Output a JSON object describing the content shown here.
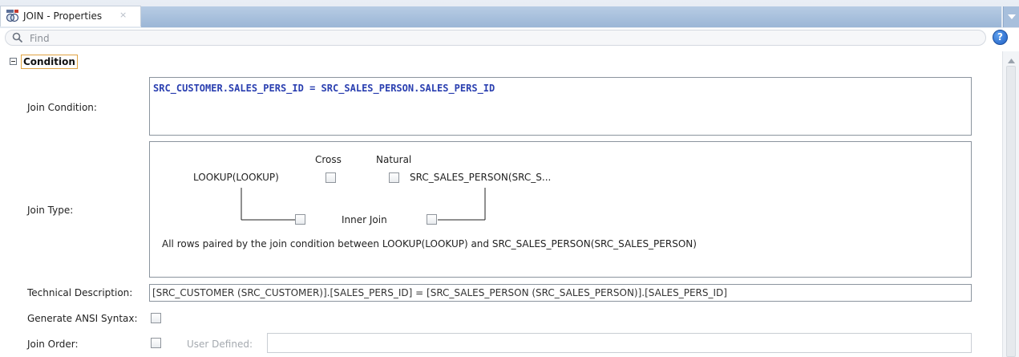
{
  "tab": {
    "title": "JOIN - Properties",
    "close_glyph": "×",
    "icon": "join-properties-icon"
  },
  "find": {
    "placeholder": "Find",
    "value": "",
    "help_glyph": "?"
  },
  "section": {
    "title": "Condition",
    "expanded": true
  },
  "labels": {
    "join_condition": "Join Condition:",
    "join_type": "Join Type:",
    "technical_description": "Technical Description:",
    "generate_ansi": "Generate ANSI Syntax:",
    "join_order": "Join Order:",
    "user_defined": "User Defined:"
  },
  "join_condition": {
    "expression": "SRC_CUSTOMER.SALES_PERS_ID = SRC_SALES_PERSON.SALES_PERS_ID"
  },
  "join_type": {
    "cross_label": "Cross",
    "natural_label": "Natural",
    "left_source": "LOOKUP(LOOKUP)",
    "right_source": "SRC_SALES_PERSON(SRC_S...",
    "inner_join_label": "Inner Join",
    "description": "All rows paired by the join condition between LOOKUP(LOOKUP) and SRC_SALES_PERSON(SRC_SALES_PERSON)",
    "cross_checked": false,
    "natural_checked": false,
    "left_outer_checked": false,
    "right_outer_checked": false
  },
  "technical_description": {
    "value": "[SRC_CUSTOMER (SRC_CUSTOMER)].[SALES_PERS_ID] = [SRC_SALES_PERSON (SRC_SALES_PERSON)].[SALES_PERS_ID]"
  },
  "generate_ansi_checked": false,
  "join_order_checked": false,
  "user_defined": {
    "value": ""
  },
  "colors": {
    "condition_text": "#2a3fb0",
    "tab_strip": "#9bb6d6",
    "section_highlight": "#e0a341",
    "help_button": "#1f5fc4"
  }
}
